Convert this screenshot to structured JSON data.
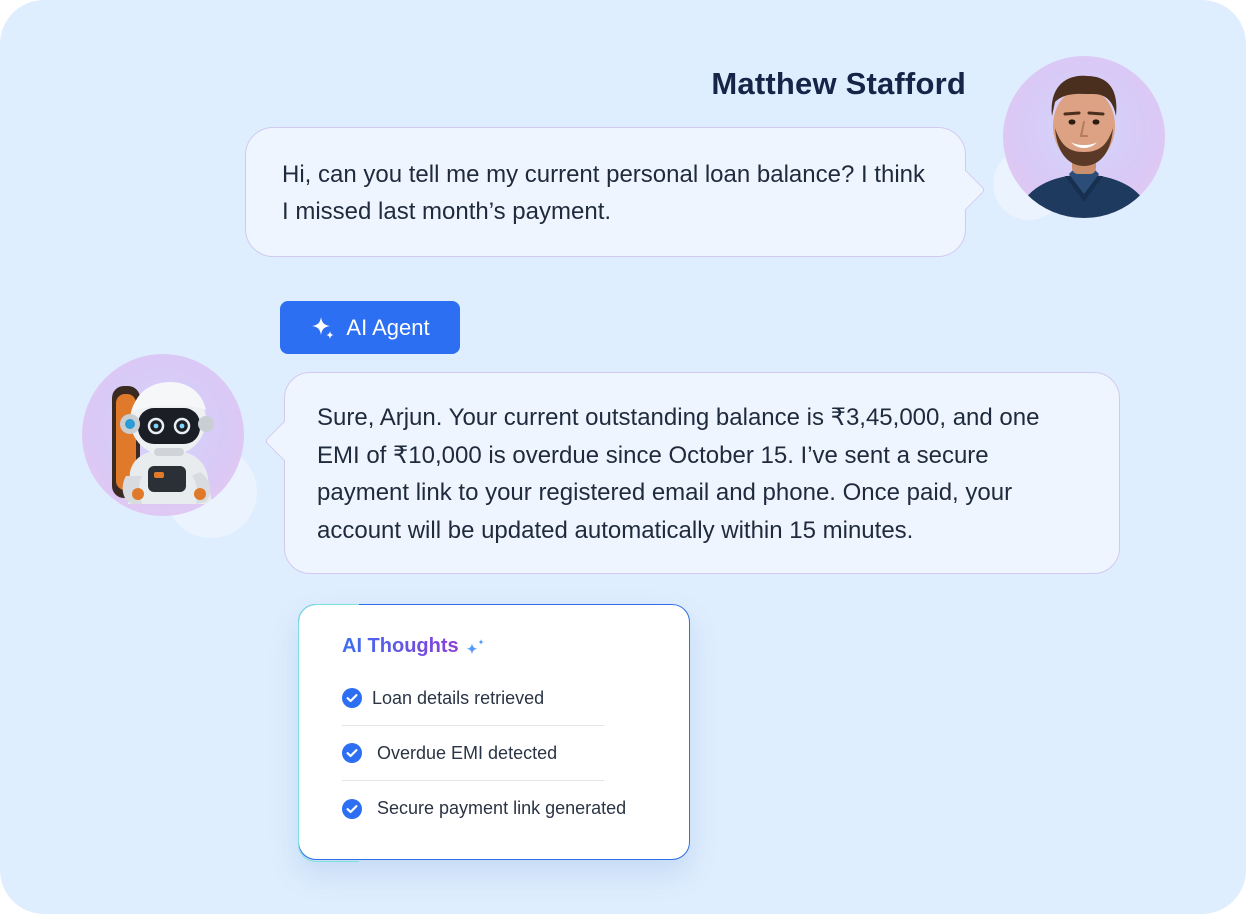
{
  "user": {
    "name": "Matthew Stafford",
    "message": "Hi, can you tell me my current personal loan balance? I think I missed last month’s payment."
  },
  "agent": {
    "tag_label": "AI Agent",
    "message": "Sure, Arjun. Your current outstanding balance is ₹3,45,000, and one EMI of ₹10,000 is overdue since October 15. I’ve sent a secure payment link to your registered email and phone. Once paid, your account will be updated automatically within 15 minutes."
  },
  "thoughts": {
    "title": "AI Thoughts",
    "items": [
      {
        "label": "Loan details retrieved",
        "status": "done"
      },
      {
        "label": "Overdue EMI detected",
        "status": "done"
      },
      {
        "label": "Secure payment link generated",
        "status": "done"
      }
    ]
  },
  "icons": {
    "agent_tag": "sparkle-icon",
    "thoughts_title": "sparkle-icon",
    "item_status": "check-circle-icon"
  },
  "colors": {
    "background": "#dfeefe",
    "accent_blue": "#2d6ff2",
    "name_text": "#152447",
    "bubble_fill": "#eef5fe",
    "bubble_border": "#d2c9f0",
    "thoughts_gradient_start": "#3b6ff0",
    "thoughts_gradient_end": "#8a3fd6"
  }
}
